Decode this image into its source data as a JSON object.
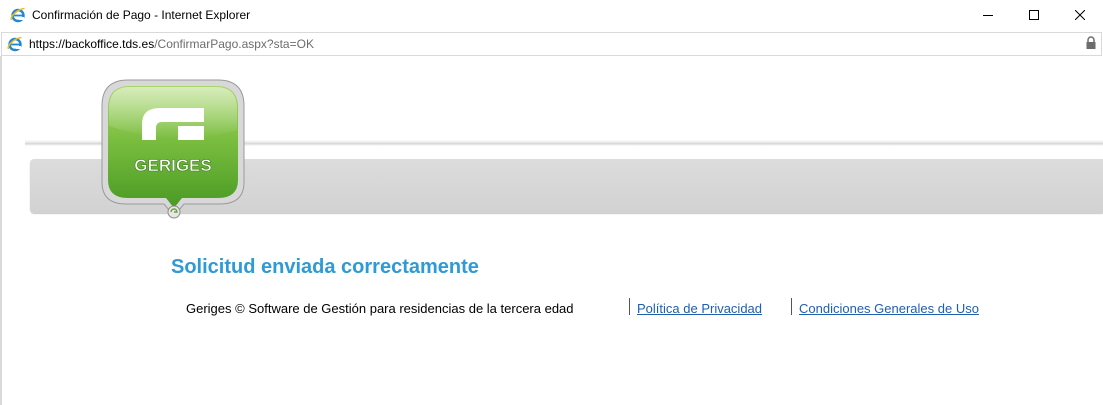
{
  "window": {
    "title": "Confirmación de Pago - Internet Explorer",
    "controls": [
      "minimize",
      "maximize",
      "close"
    ]
  },
  "address_bar": {
    "url_scheme": "https://",
    "url_host": "backoffice.tds.es",
    "url_rest": "/ConfirmarPago.aspx?sta=OK",
    "secure_icon": "lock-icon"
  },
  "logo": {
    "text": "GERIGES",
    "color_primary": "#7cc242",
    "color_dark": "#3f8a1f"
  },
  "main": {
    "heading": "Solicitud enviada correctamente",
    "heading_color": "#2e9ad6"
  },
  "footer": {
    "copyright": "Geriges © Software de Gestión para residencias de la tercera edad",
    "links": [
      {
        "label": "Política de Privacidad"
      },
      {
        "label": "Condiciones Generales de Uso"
      }
    ],
    "link_color": "#1f5fae"
  }
}
